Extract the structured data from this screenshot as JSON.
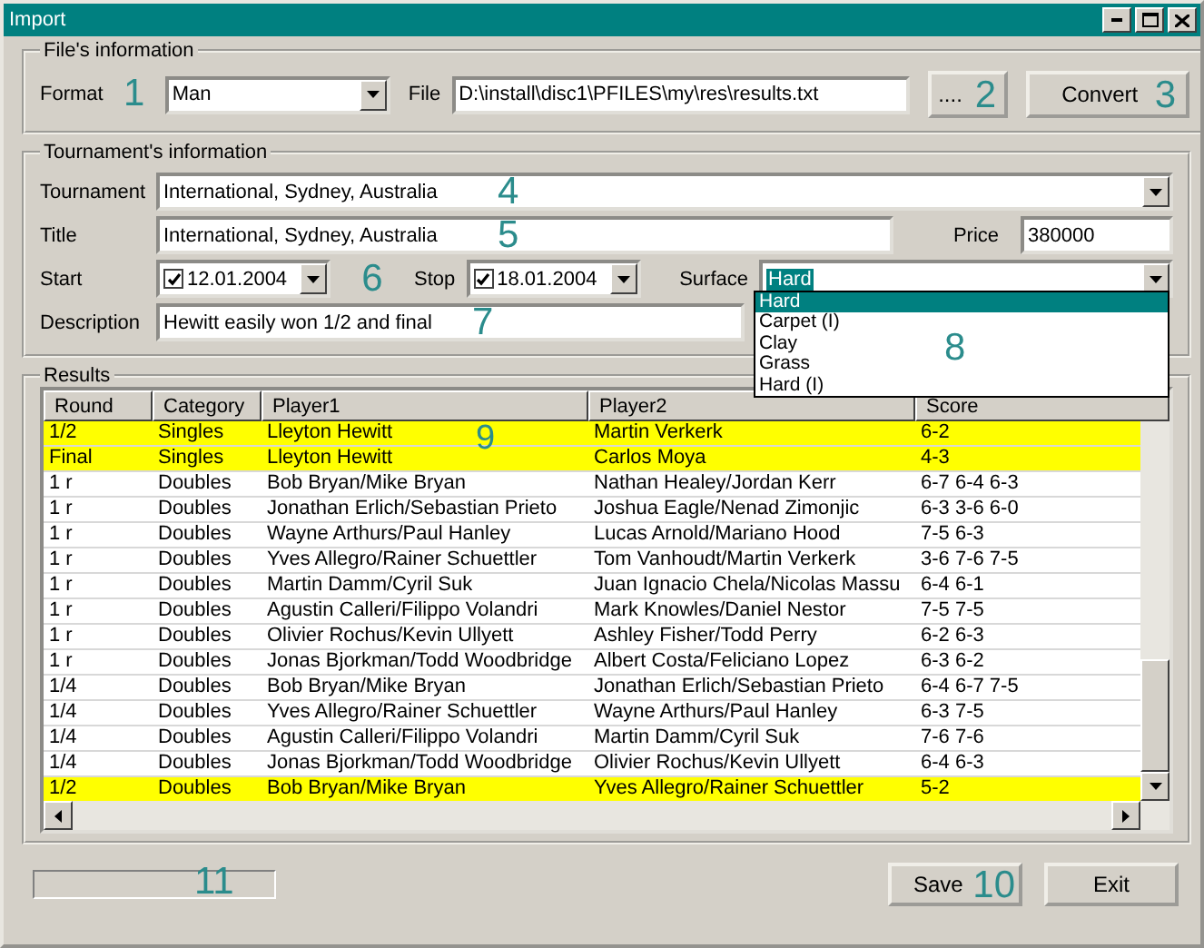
{
  "window": {
    "title": "Import"
  },
  "file_info": {
    "legend": "File's information",
    "format_label": "Format",
    "format_value": "Man",
    "file_label": "File",
    "file_value": "D:\\install\\disc1\\PFILES\\my\\res\\results.txt",
    "browse_button": "....",
    "convert_button": "Convert"
  },
  "tournament_info": {
    "legend": "Tournament's information",
    "tournament_label": "Tournament",
    "tournament_value": "International, Sydney, Australia",
    "title_label": "Title",
    "title_value": "International, Sydney, Australia",
    "price_label": "Price",
    "price_value": "380000",
    "start": {
      "label": "Start",
      "checked": true,
      "value": "12.01.2004"
    },
    "stop": {
      "label": "Stop",
      "checked": true,
      "value": "18.01.2004"
    },
    "surface_label": "Surface",
    "surface_value": "Hard",
    "surface_options": [
      {
        "label": "Hard",
        "selected": true
      },
      {
        "label": "Carpet (I)",
        "selected": false
      },
      {
        "label": "Clay",
        "selected": false
      },
      {
        "label": "Grass",
        "selected": false
      },
      {
        "label": "Hard (I)",
        "selected": false
      }
    ],
    "description_label": "Description",
    "description_value": "Hewitt easily won 1/2 and final"
  },
  "results": {
    "legend": "Results",
    "columns": [
      "Round",
      "Category",
      "Player1",
      "Player2",
      "Score"
    ],
    "rows": [
      {
        "highlighted": true,
        "cells": [
          "1/2",
          "Singles",
          "Lleyton Hewitt",
          "Martin Verkerk",
          "6-2"
        ]
      },
      {
        "highlighted": true,
        "cells": [
          "Final",
          "Singles",
          "Lleyton Hewitt",
          "Carlos Moya",
          "4-3"
        ]
      },
      {
        "highlighted": false,
        "cells": [
          "1 r",
          "Doubles",
          "Bob Bryan/Mike Bryan",
          "Nathan Healey/Jordan Kerr",
          "6-7 6-4 6-3"
        ]
      },
      {
        "highlighted": false,
        "cells": [
          "1 r",
          "Doubles",
          "Jonathan Erlich/Sebastian Prieto",
          "Joshua Eagle/Nenad Zimonjic",
          "6-3 3-6 6-0"
        ]
      },
      {
        "highlighted": false,
        "cells": [
          "1 r",
          "Doubles",
          "Wayne Arthurs/Paul Hanley",
          "Lucas Arnold/Mariano Hood",
          "7-5 6-3"
        ]
      },
      {
        "highlighted": false,
        "cells": [
          "1 r",
          "Doubles",
          "Yves Allegro/Rainer Schuettler",
          "Tom Vanhoudt/Martin Verkerk",
          "3-6 7-6 7-5"
        ]
      },
      {
        "highlighted": false,
        "cells": [
          "1 r",
          "Doubles",
          "Martin Damm/Cyril Suk",
          "Juan Ignacio Chela/Nicolas Massu",
          "6-4 6-1"
        ]
      },
      {
        "highlighted": false,
        "cells": [
          "1 r",
          "Doubles",
          "Agustin Calleri/Filippo Volandri",
          "Mark Knowles/Daniel Nestor",
          "7-5 7-5"
        ]
      },
      {
        "highlighted": false,
        "cells": [
          "1 r",
          "Doubles",
          "Olivier Rochus/Kevin Ullyett",
          "Ashley Fisher/Todd Perry",
          "6-2 6-3"
        ]
      },
      {
        "highlighted": false,
        "cells": [
          "1 r",
          "Doubles",
          "Jonas Bjorkman/Todd Woodbridge",
          "Albert Costa/Feliciano Lopez",
          "6-3 6-2"
        ]
      },
      {
        "highlighted": false,
        "cells": [
          "1/4",
          "Doubles",
          "Bob Bryan/Mike Bryan",
          "Jonathan Erlich/Sebastian Prieto",
          "6-4 6-7 7-5"
        ]
      },
      {
        "highlighted": false,
        "cells": [
          "1/4",
          "Doubles",
          "Yves Allegro/Rainer Schuettler",
          "Wayne Arthurs/Paul Hanley",
          "6-3 7-5"
        ]
      },
      {
        "highlighted": false,
        "cells": [
          "1/4",
          "Doubles",
          "Agustin Calleri/Filippo Volandri",
          "Martin Damm/Cyril Suk",
          "7-6 7-6"
        ]
      },
      {
        "highlighted": false,
        "cells": [
          "1/4",
          "Doubles",
          "Jonas Bjorkman/Todd Woodbridge",
          "Olivier Rochus/Kevin Ullyett",
          "6-4 6-3"
        ]
      },
      {
        "highlighted": true,
        "cells": [
          "1/2",
          "Doubles",
          "Bob Bryan/Mike Bryan",
          "Yves Allegro/Rainer Schuettler",
          "5-2"
        ]
      }
    ]
  },
  "buttons": {
    "save": "Save",
    "exit": "Exit"
  },
  "callouts": [
    {
      "text": "1"
    },
    {
      "text": "2"
    },
    {
      "text": "3"
    },
    {
      "text": "4"
    },
    {
      "text": "5"
    },
    {
      "text": "6"
    },
    {
      "text": "7"
    },
    {
      "text": "8"
    },
    {
      "text": "9"
    },
    {
      "text": "10"
    },
    {
      "text": "11"
    }
  ]
}
